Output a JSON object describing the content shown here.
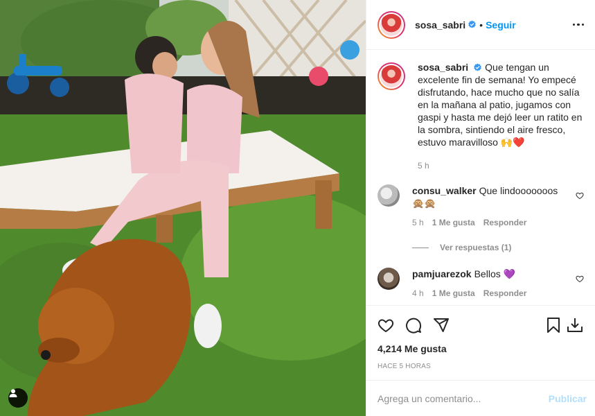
{
  "post": {
    "username": "sosa_sabri",
    "verified": true,
    "follow_label": "Seguir",
    "separator": "•",
    "caption": "Que tengan un excelente fin de semana! Yo empecé disfrutando, hace mucho que no salía en la mañana al patio, jugamos con gaspi y hasta me dejó leer un ratito en la sombra, sintiendo el aire fresco, estuvo maravilloso 🙌❤️",
    "caption_time": "5 h"
  },
  "comments": [
    {
      "username": "consu_walker",
      "text": "Que lindooooooos 🙊🙊",
      "time": "5 h",
      "likes": "1 Me gusta",
      "reply_label": "Responder",
      "view_replies": "Ver respuestas (1)"
    },
    {
      "username": "pamjuarezok",
      "text": "Bellos 💜",
      "time": "4 h",
      "likes": "1 Me gusta",
      "reply_label": "Responder"
    }
  ],
  "stats": {
    "likes": "4,214 Me gusta",
    "time_ago": "HACE 5 HORAS"
  },
  "composer": {
    "placeholder": "Agrega un comentario...",
    "post_label": "Publicar"
  },
  "colors": {
    "accent": "#0095f6",
    "publish_disabled": "#b2dffc",
    "heart_red": "#ed4956"
  },
  "icons": {
    "verified": "verified-badge-icon",
    "more": "more-options-icon",
    "like": "heart-icon",
    "comment": "comment-icon",
    "share": "share-icon",
    "save": "bookmark-icon",
    "download": "download-icon",
    "tag": "user-tag-icon"
  }
}
